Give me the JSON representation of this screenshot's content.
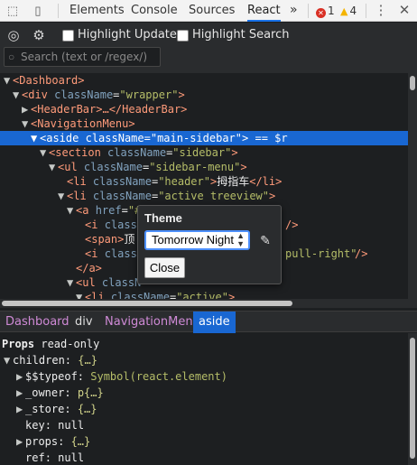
{
  "devtools": {
    "tabs": [
      {
        "label": "Elements"
      },
      {
        "label": "Console"
      },
      {
        "label": "Sources"
      },
      {
        "label": "React"
      }
    ],
    "more_label": "»",
    "error_count": "1",
    "warning_count": "4"
  },
  "toolbar": {
    "highlight_updates_label": "Highlight Updates",
    "highlight_updates_checked": false,
    "highlight_search_label": "Highlight Search",
    "highlight_search_checked": false,
    "search_placeholder": "Search (text or /regex/)"
  },
  "tree": {
    "rows": [
      {
        "arrow": "▼",
        "tag_open": "<Dashboard",
        "tag_close": ">"
      },
      {
        "arrow": "▼",
        "tag_open": "<div",
        "attr": "className",
        "value": "\"wrapper\"",
        "tag_close": ">"
      },
      {
        "arrow": "▶",
        "tag_open": "<HeaderBar",
        "tag_close": ">…</HeaderBar>"
      },
      {
        "arrow": "▼",
        "tag_open": "<NavigationMenu",
        "tag_close": ">"
      },
      {
        "arrow": "▼",
        "tag_open": "<aside",
        "attr": "className",
        "value": "\"main-sidebar\"",
        "tag_close": ">",
        "suffix": " == $r"
      },
      {
        "arrow": "▼",
        "tag_open": "<section",
        "attr": "className",
        "value": "\"sidebar\"",
        "tag_close": ">"
      },
      {
        "arrow": "▼",
        "tag_open": "<ul",
        "attr": "className",
        "value": "\"sidebar-menu\"",
        "tag_close": ">"
      },
      {
        "arrow": "",
        "tag_open": "<li",
        "attr": "className",
        "value": "\"header\"",
        "tag_close": ">",
        "text": "拇指车",
        "end_tag": "</li>"
      },
      {
        "arrow": "▼",
        "tag_open": "<li",
        "attr": "className",
        "value": "\"active treeview\"",
        "tag_close": ">"
      },
      {
        "arrow": "▼",
        "tag_open": "<a",
        "attr": "href",
        "value": "\"#",
        "tag_close": ""
      },
      {
        "arrow": "",
        "tag_open": "<i",
        "attr": "classN",
        "value": "",
        "tag_close": "",
        "tail": "/>"
      },
      {
        "arrow": "",
        "tag_open": "<span>",
        "attr": "",
        "value": "",
        "tag_close": "",
        "text": "顶"
      },
      {
        "arrow": "",
        "tag_open": "<i",
        "attr": "classN",
        "value": "",
        "tag_close": "",
        "tail_val": "pull-right\"",
        "tail": " />"
      },
      {
        "arrow": "",
        "tag_open": "</a>",
        "attr": "",
        "value": "",
        "tag_close": ""
      },
      {
        "arrow": "▼",
        "tag_open": "<ul",
        "attr": "classN",
        "value": "",
        "tag_close": ""
      },
      {
        "arrow": "▼",
        "tag_open": "<li",
        "attr": "className",
        "value": "\"active\"",
        "tag_close": ">"
      }
    ]
  },
  "popup": {
    "title": "Theme",
    "selected_theme": "Tomorrow Night",
    "close_label": "Close"
  },
  "breadcrumb": {
    "items": [
      {
        "label": "Dashboard"
      },
      {
        "label": "div"
      },
      {
        "label": "NavigationMenu"
      },
      {
        "label": "aside"
      }
    ]
  },
  "props": {
    "header_label": "Props",
    "header_note": "read-only",
    "rows": [
      {
        "arrow": "▼",
        "key": "children",
        "value": "{…}",
        "kind": "obj"
      },
      {
        "arrow": "▶",
        "key": "$$typeof",
        "value": "Symbol(react.element)",
        "kind": "sym"
      },
      {
        "arrow": "▶",
        "key": "_owner",
        "value": "p{…}",
        "kind": "obj"
      },
      {
        "arrow": "▶",
        "key": "_store",
        "value": "{…}",
        "kind": "obj"
      },
      {
        "arrow": "",
        "key": "key",
        "value": "null",
        "kind": "null"
      },
      {
        "arrow": "▶",
        "key": "props",
        "value": "{…}",
        "kind": "obj"
      },
      {
        "arrow": "",
        "key": "ref",
        "value": "null",
        "kind": "null"
      }
    ]
  }
}
